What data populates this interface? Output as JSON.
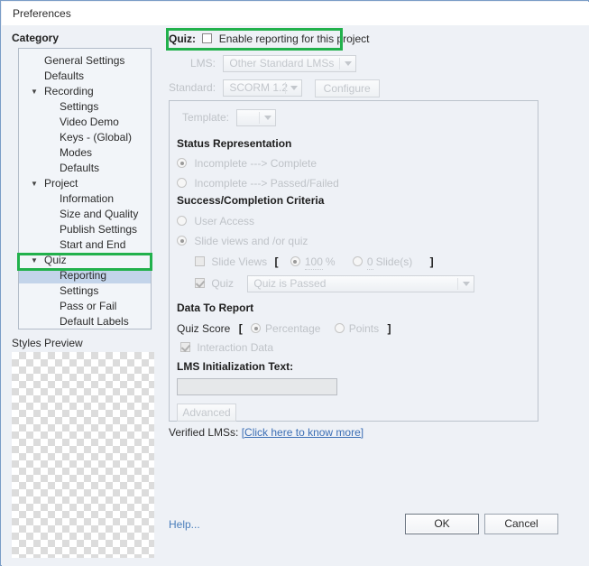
{
  "window": {
    "title": "Preferences"
  },
  "sidebar": {
    "heading": "Category",
    "items": [
      {
        "label": "General Settings",
        "level": 1,
        "arrow": "",
        "selected": false
      },
      {
        "label": "Defaults",
        "level": 1,
        "arrow": "",
        "selected": false
      },
      {
        "label": "Recording",
        "level": 1,
        "arrow": "▼",
        "selected": false
      },
      {
        "label": "Settings",
        "level": 2,
        "arrow": "",
        "selected": false
      },
      {
        "label": "Video Demo",
        "level": 2,
        "arrow": "",
        "selected": false
      },
      {
        "label": "Keys - (Global)",
        "level": 2,
        "arrow": "",
        "selected": false
      },
      {
        "label": "Modes",
        "level": 2,
        "arrow": "",
        "selected": false
      },
      {
        "label": "Defaults",
        "level": 2,
        "arrow": "",
        "selected": false
      },
      {
        "label": "Project",
        "level": 1,
        "arrow": "▼",
        "selected": false
      },
      {
        "label": "Information",
        "level": 2,
        "arrow": "",
        "selected": false
      },
      {
        "label": "Size and Quality",
        "level": 2,
        "arrow": "",
        "selected": false
      },
      {
        "label": "Publish Settings",
        "level": 2,
        "arrow": "",
        "selected": false
      },
      {
        "label": "Start and End",
        "level": 2,
        "arrow": "",
        "selected": false
      },
      {
        "label": "Quiz",
        "level": 1,
        "arrow": "▼",
        "selected": false
      },
      {
        "label": "Reporting",
        "level": 2,
        "arrow": "",
        "selected": true
      },
      {
        "label": "Settings",
        "level": 2,
        "arrow": "",
        "selected": false
      },
      {
        "label": "Pass or Fail",
        "level": 2,
        "arrow": "",
        "selected": false
      },
      {
        "label": "Default Labels",
        "level": 2,
        "arrow": "",
        "selected": false
      }
    ],
    "styles_preview_label": "Styles Preview"
  },
  "main": {
    "quiz_label": "Quiz:",
    "enable_reporting_label": "Enable reporting for this project",
    "enable_reporting_checked": false,
    "lms_label": "LMS:",
    "lms_value": "Other Standard LMSs",
    "standard_label": "Standard:",
    "standard_value": "SCORM 1.2",
    "configure_label": "Configure",
    "template_label": "Template:",
    "template_value": "",
    "status_representation_heading": "Status Representation",
    "status_options": [
      {
        "label": "Incomplete ---> Complete",
        "selected": true
      },
      {
        "label": "Incomplete ---> Passed/Failed",
        "selected": false
      }
    ],
    "success_criteria_heading": "Success/Completion Criteria",
    "criteria_options": [
      {
        "label": "User Access",
        "selected": false
      },
      {
        "label": "Slide views and /or quiz",
        "selected": true
      }
    ],
    "slide_views_label": "Slide Views",
    "slide_views_checked": false,
    "bracket_open": "[",
    "bracket_close": "]",
    "percent_value": "100",
    "percent_unit": "%",
    "percent_selected": true,
    "slides_value": "0",
    "slides_unit": "Slide(s)",
    "slides_selected": false,
    "quiz_check_label": "Quiz",
    "quiz_check_checked": true,
    "quiz_condition_value": "Quiz is Passed",
    "data_to_report_heading": "Data To Report",
    "quiz_score_label": "Quiz Score",
    "percentage_label": "Percentage",
    "percentage_selected": true,
    "points_label": "Points",
    "points_selected": false,
    "interaction_data_label": "Interaction Data",
    "interaction_data_checked": true,
    "lms_init_heading": "LMS Initialization Text:",
    "lms_init_value": "",
    "advanced_label": "Advanced",
    "verified_lms_label": "Verified LMSs:",
    "verified_lms_link": "[Click here to know more]"
  },
  "footer": {
    "help_label": "Help...",
    "ok_label": "OK",
    "cancel_label": "Cancel"
  },
  "colors": {
    "highlight": "#22b14c",
    "selection": "#c3d4ea",
    "link": "#3c6fb5",
    "window_border": "#7a9cc6"
  }
}
